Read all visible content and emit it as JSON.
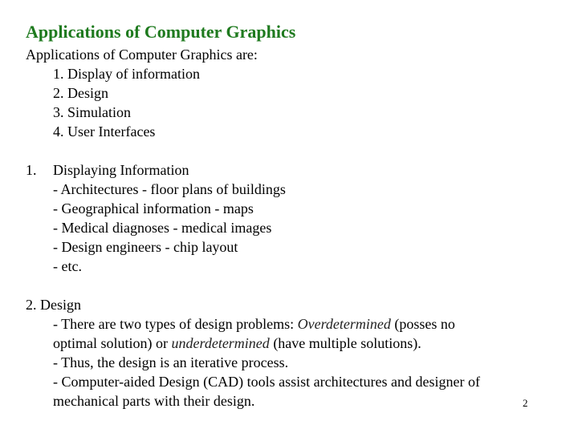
{
  "title": "Applications of Computer Graphics",
  "intro": "Applications of Computer Graphics are:",
  "apps": [
    "1. Display of information",
    "2. Design",
    "3. Simulation",
    "4. User Interfaces"
  ],
  "section1": {
    "number": "1.",
    "heading": "Displaying Information",
    "items": [
      "- Architectures - floor plans of buildings",
      "- Geographical information - maps",
      "- Medical diagnoses - medical images",
      "- Design engineers - chip layout",
      "- etc."
    ]
  },
  "section2": {
    "heading": "2. Design",
    "line1_pre": "- There are two types of design problems: ",
    "line1_em": "Overdetermined",
    "line1_post": " (posses no",
    "line2_pre": "optimal solution) or ",
    "line2_em": "underdetermined",
    "line2_post": " (have multiple solutions).",
    "line3": "- Thus, the design is an iterative process.",
    "line4": "- Computer-aided Design (CAD) tools assist architectures and designer of",
    "line5": "mechanical parts with their design."
  },
  "page_number": "2"
}
